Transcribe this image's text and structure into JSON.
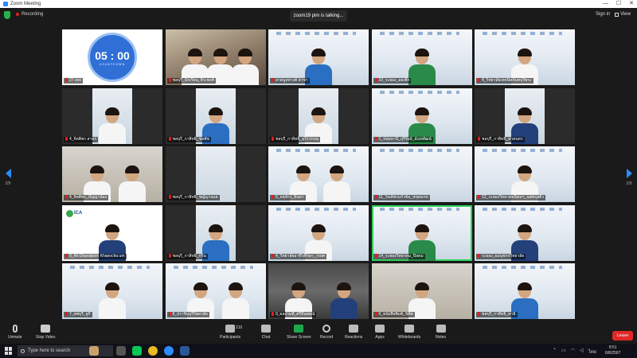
{
  "window": {
    "title": "Zoom Meeting",
    "controls": [
      "—",
      "☐",
      "✕"
    ]
  },
  "topbar": {
    "recording_label": "Recording",
    "talking": "zoom19 pim is talking...",
    "sign_in": "Sign in",
    "view": "View"
  },
  "nav": {
    "left_page": "2/9",
    "right_page": "2/9"
  },
  "timer": {
    "time": "05 : 00",
    "caption": "COUNTDOWN"
  },
  "tiles": [
    {
      "name": "27 zoo"
    },
    {
      "name": "ชลบุรี_นักเรียน_จิระพงศ์"
    },
    {
      "name": "ลาดบูลทางค์ สาขา"
    },
    {
      "name": "10_ระยอง_ลอเพิก"
    },
    {
      "name": "4_วิทยาลัยเทคนิคจันทบุรีพระ"
    },
    {
      "name": "4_จิตติพร สาคร"
    },
    {
      "name": "ชลบุรี_กาสิทธิ์_ชลพัช"
    },
    {
      "name": "ชลบุรี_กาสิทธิ์_อุไรวรรณ"
    },
    {
      "name": "1_ปทุมธานี_บุรีรัมย์_ฉันทพัฒน์"
    },
    {
      "name": "ชลบุรี_กาสิทธิ์_ควยนคร"
    },
    {
      "name": "4_จิตติพร_บัญญาน้อง"
    },
    {
      "name": "ชลบุรี_กาสิทธิ์_ชญัญาณเย"
    },
    {
      "name": "6_จตุจักร_จินดา"
    },
    {
      "name": "11_ใจเพ็ชรแก้วข้อ_หทุดมกท"
    },
    {
      "name": "12_ระยองวิทยาคมนิคมฯ_นพชกุลผิว"
    },
    {
      "name": "8_Mr.Ghanakorn Khaeocha um",
      "logo": "ICA"
    },
    {
      "name": "ชลบุรี_กาสิทธิ์_กริน"
    },
    {
      "name": "4_วิทยาลัยอาชีวศึกษา_วรยศ"
    },
    {
      "name": "14_ระยองวิทยาคม_ปิลดม"
    },
    {
      "name": "ระยอง_ผมนุชกรวิทยาลัย"
    },
    {
      "name": "7_ลพบุรี_ลูกิ"
    },
    {
      "name": "8_ปราจีนบุรีวิทยาลัย"
    },
    {
      "name": "9_ผลงานที่_ศรีจีนพยณ์"
    },
    {
      "name": "6_หนังสือพิมพ์_นิติศ"
    },
    {
      "name": "ชลบุรี_กาสิทธิ์_คามิ"
    }
  ],
  "toolbar": {
    "unmute": "Unmute",
    "stop_video": "Stop Video",
    "participants": "Participants",
    "participant_count": "210",
    "chat": "Chat",
    "share_screen": "Share Screen",
    "record": "Record",
    "reactions": "Reactions",
    "apps": "Apps",
    "whiteboards": "Whiteboards",
    "notes": "Notes",
    "leave": "Leave"
  },
  "taskbar": {
    "search_placeholder": "Type here to search",
    "lang": "ไทย",
    "time": "8:51",
    "date": "6/8/2567"
  }
}
